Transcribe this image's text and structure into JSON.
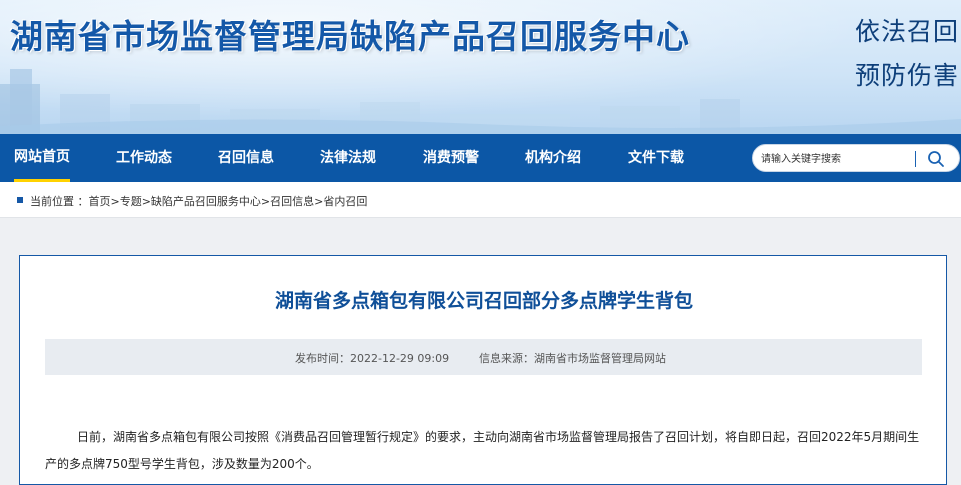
{
  "header": {
    "site_title": "湖南省市场监督管理局缺陷产品召回服务中心",
    "slogan_line1": "依法召回",
    "slogan_line2": "预防伤害"
  },
  "nav": {
    "items": [
      {
        "label": "网站首页",
        "active": true
      },
      {
        "label": "工作动态"
      },
      {
        "label": "召回信息"
      },
      {
        "label": "法律法规"
      },
      {
        "label": "消费预警"
      },
      {
        "label": "机构介绍"
      },
      {
        "label": "文件下载"
      }
    ]
  },
  "search": {
    "placeholder": "请输入关键字搜索",
    "icon": "search-icon"
  },
  "breadcrumb": {
    "prefix": "当前位置 ：",
    "path": "首页>专题>缺陷产品召回服务中心>召回信息>省内召回"
  },
  "article": {
    "title": "湖南省多点箱包有限公司召回部分多点牌学生背包",
    "publish_time": "发布时间：2022-12-29 09:09",
    "source": "信息来源：湖南省市场监督管理局网站",
    "paragraph1": "日前，湖南省多点箱包有限公司按照《消费品召回管理暂行规定》的要求，主动向湖南省市场监督管理局报告了召回计划，将自即日起，召回2022年5月期间生产的多点牌750型号学生背包，涉及数量为200个。"
  },
  "colors": {
    "nav_bg": "#0c57a6",
    "title_blue": "#1458a8",
    "active_underline": "#ffd200"
  }
}
